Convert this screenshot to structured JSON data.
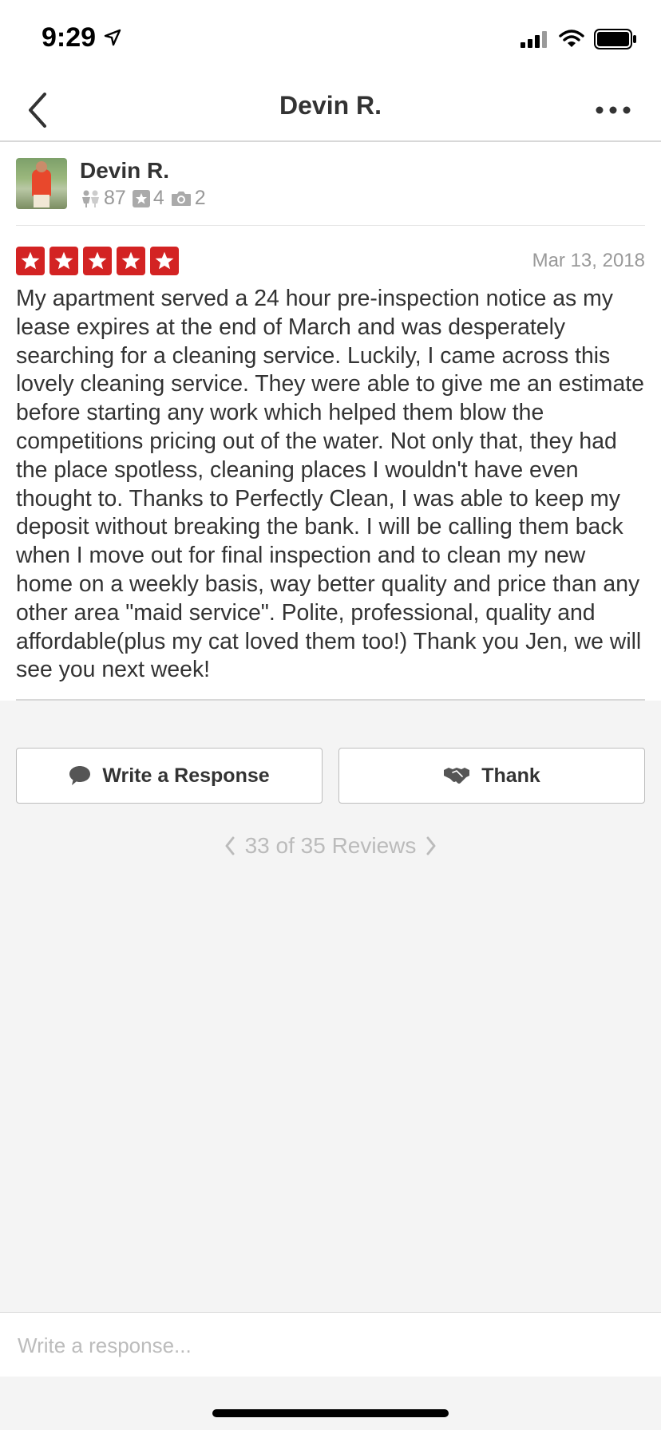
{
  "status_bar": {
    "time": "9:29"
  },
  "nav": {
    "title": "Devin R."
  },
  "user": {
    "name": "Devin R.",
    "friends_count": "87",
    "reviews_count": "4",
    "photos_count": "2"
  },
  "review": {
    "rating": 5,
    "date": "Mar 13, 2018",
    "text": "My apartment served a 24 hour pre-inspection notice as my lease expires at the end of March and was desperately searching for a cleaning service. Luckily, I came across this lovely cleaning service. They were able to give me an estimate before starting any work which helped them blow the competitions pricing out of the water. Not only that, they had the place spotless, cleaning places I wouldn't have even thought to. Thanks to Perfectly Clean, I was able to keep my deposit without breaking the bank. I will be calling them back when I move out for final inspection and to clean my new home on a weekly basis, way better quality and price than any other area \"maid service\". Polite, professional, quality and affordable(plus my cat loved them too!) Thank you Jen, we will see you next week!"
  },
  "actions": {
    "write_response_label": "Write a Response",
    "thank_label": "Thank"
  },
  "pager": {
    "label": "33 of 35 Reviews"
  },
  "composer": {
    "placeholder": "Write a response..."
  },
  "colors": {
    "star_red": "#d32323",
    "text_primary": "#333333",
    "text_muted": "#999999",
    "background": "#f4f4f4"
  },
  "icons": {
    "back": "chevron-left-icon",
    "more": "more-horizontal-icon",
    "friends": "friends-icon",
    "reviews": "star-square-icon",
    "photos": "camera-icon",
    "speech": "speech-bubble-icon",
    "thank": "handshake-icon"
  }
}
